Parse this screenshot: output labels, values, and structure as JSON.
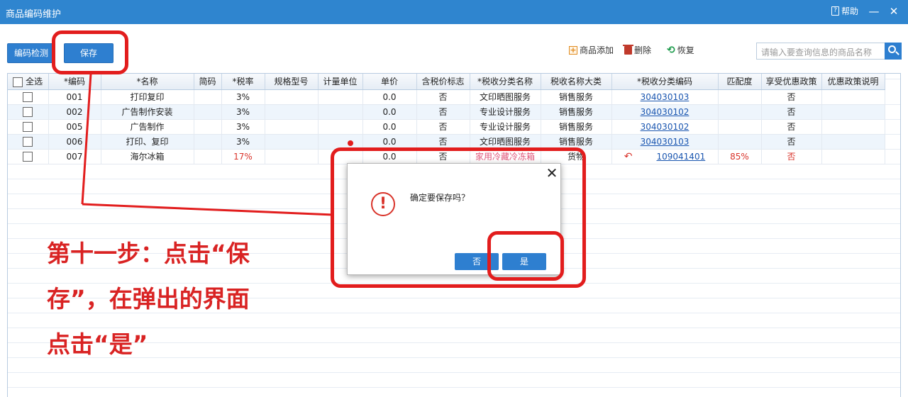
{
  "window": {
    "title": "商品编码维护",
    "help_label": "帮助",
    "minimize_glyph": "—",
    "close_glyph": "✕"
  },
  "toolbar": {
    "check_label": "编码检测",
    "save_label": "保存",
    "add_label": "商品添加",
    "delete_label": "删除",
    "restore_label": "恢复",
    "search_placeholder": "请输入要查询信息的商品名称"
  },
  "table": {
    "select_all_label": "全选",
    "headers": [
      "*编码",
      "*名称",
      "简码",
      "*税率",
      "规格型号",
      "计量单位",
      "单价",
      "含税价标志",
      "*税收分类名称",
      "税收名称大类",
      "*税收分类编码",
      "匹配度",
      "享受优惠政策",
      "优惠政策说明"
    ],
    "rows": [
      {
        "code": "001",
        "name": "打印复印",
        "short": "",
        "tax_rate": "3%",
        "spec": "",
        "unit": "",
        "price": "0.0",
        "tax_incl": "否",
        "tax_cat_name": "文印晒图服务",
        "tax_class": "销售服务",
        "tax_cat_code": "304030103",
        "match": "",
        "preferential": "否",
        "pref_note": ""
      },
      {
        "code": "002",
        "name": "广告制作安装",
        "short": "",
        "tax_rate": "3%",
        "spec": "",
        "unit": "",
        "price": "0.0",
        "tax_incl": "否",
        "tax_cat_name": "专业设计服务",
        "tax_class": "销售服务",
        "tax_cat_code": "304030102",
        "match": "",
        "preferential": "否",
        "pref_note": ""
      },
      {
        "code": "005",
        "name": "广告制作",
        "short": "",
        "tax_rate": "3%",
        "spec": "",
        "unit": "",
        "price": "0.0",
        "tax_incl": "否",
        "tax_cat_name": "专业设计服务",
        "tax_class": "销售服务",
        "tax_cat_code": "304030102",
        "match": "",
        "preferential": "否",
        "pref_note": ""
      },
      {
        "code": "006",
        "name": "打印、复印",
        "short": "",
        "tax_rate": "3%",
        "spec": "",
        "unit": "",
        "price": "0.0",
        "tax_incl": "否",
        "tax_cat_name": "文印晒图服务",
        "tax_class": "销售服务",
        "tax_cat_code": "304030103",
        "match": "",
        "preferential": "否",
        "pref_note": ""
      },
      {
        "code": "007",
        "name": "海尔冰箱",
        "short": "",
        "tax_rate": "17%",
        "spec": "",
        "unit": "",
        "price": "0.0",
        "tax_incl": "否",
        "tax_cat_name": "家用冷藏冷冻箱",
        "tax_class": "货物",
        "tax_cat_code": "109041401",
        "match": "85%",
        "preferential": "否",
        "pref_note": ""
      }
    ]
  },
  "dialog": {
    "close_glyph": "✕",
    "icon_glyph": "!",
    "message": "确定要保存吗？",
    "no_label": "否",
    "yes_label": "是"
  },
  "annotation": {
    "line1": "第十一步：点击“保",
    "line2": "存”，在弹出的界面",
    "line3": "点击“是”",
    "color": "#e21d1d"
  },
  "colors": {
    "titlebar": "#2f85cf",
    "button": "#2e7fd0",
    "link": "#1a56b0",
    "alert": "#d9332a"
  }
}
